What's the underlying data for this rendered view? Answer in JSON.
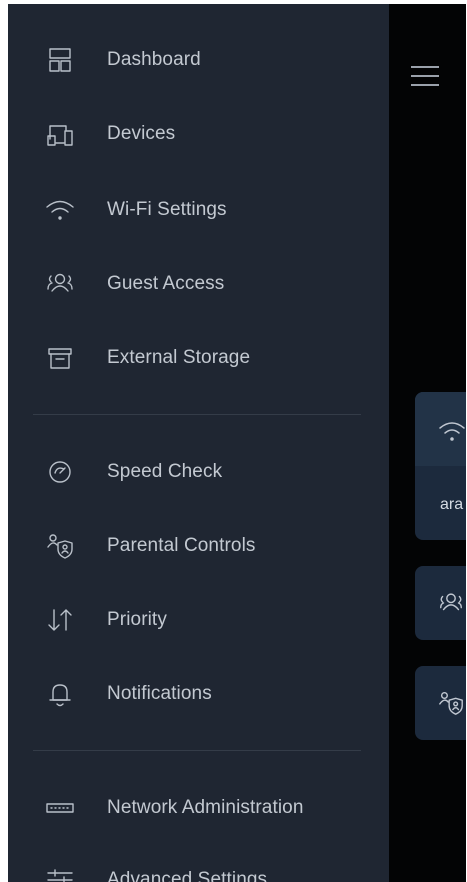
{
  "sidebar": {
    "items": [
      {
        "label": "Dashboard",
        "icon": "dashboard-icon"
      },
      {
        "label": "Devices",
        "icon": "devices-icon"
      },
      {
        "label": "Wi-Fi Settings",
        "icon": "wifi-icon"
      },
      {
        "label": "Guest Access",
        "icon": "guest-access-icon"
      },
      {
        "label": "External Storage",
        "icon": "external-storage-icon"
      },
      {
        "label": "Speed Check",
        "icon": "speedometer-icon"
      },
      {
        "label": "Parental Controls",
        "icon": "parental-controls-icon"
      },
      {
        "label": "Priority",
        "icon": "priority-arrows-icon"
      },
      {
        "label": "Notifications",
        "icon": "bell-icon"
      },
      {
        "label": "Network Administration",
        "icon": "router-icon"
      },
      {
        "label": "Advanced Settings",
        "icon": "sliders-icon"
      }
    ]
  },
  "header": {
    "menu_icon": "hamburger-menu-icon"
  },
  "background_cards": {
    "wifi_card": {
      "icon": "wifi-icon",
      "text": "ara"
    },
    "guest_card": {
      "icon": "guest-access-icon"
    },
    "parental_card": {
      "icon": "parental-controls-icon"
    }
  },
  "colors": {
    "sidebar_bg": "#1f2632",
    "main_bg": "#030405",
    "text": "#c3c9d1",
    "icon": "#b9c0c9",
    "divider": "#343c48",
    "card_bg": "#1c2a3d"
  }
}
